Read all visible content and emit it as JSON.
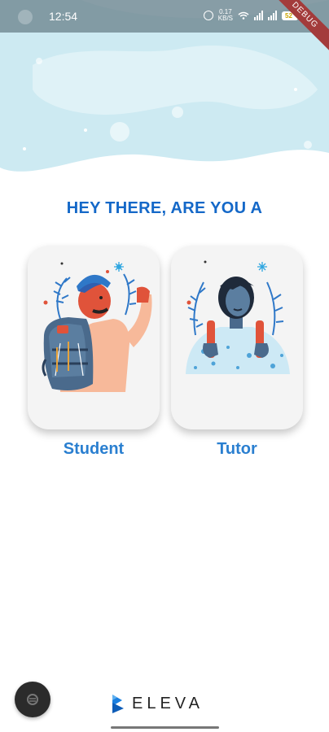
{
  "status_bar": {
    "time": "12:54",
    "net_speed": "0.17\nKB/S",
    "battery": "52"
  },
  "debug_ribbon": "DEBUG",
  "heading": "HEY THERE, ARE YOU A",
  "roles": {
    "student": {
      "label": "Student",
      "illustration": "student-hiker-illustration"
    },
    "tutor": {
      "label": "Tutor",
      "illustration": "tutor-illustration"
    }
  },
  "brand": {
    "name": "ELEVA",
    "color": "#1a7fe0"
  },
  "colors": {
    "heading": "#1468c8",
    "role_label": "#2a7fd0",
    "hero_light": "#cdeaf2",
    "card_bg": "#f4f4f4"
  }
}
